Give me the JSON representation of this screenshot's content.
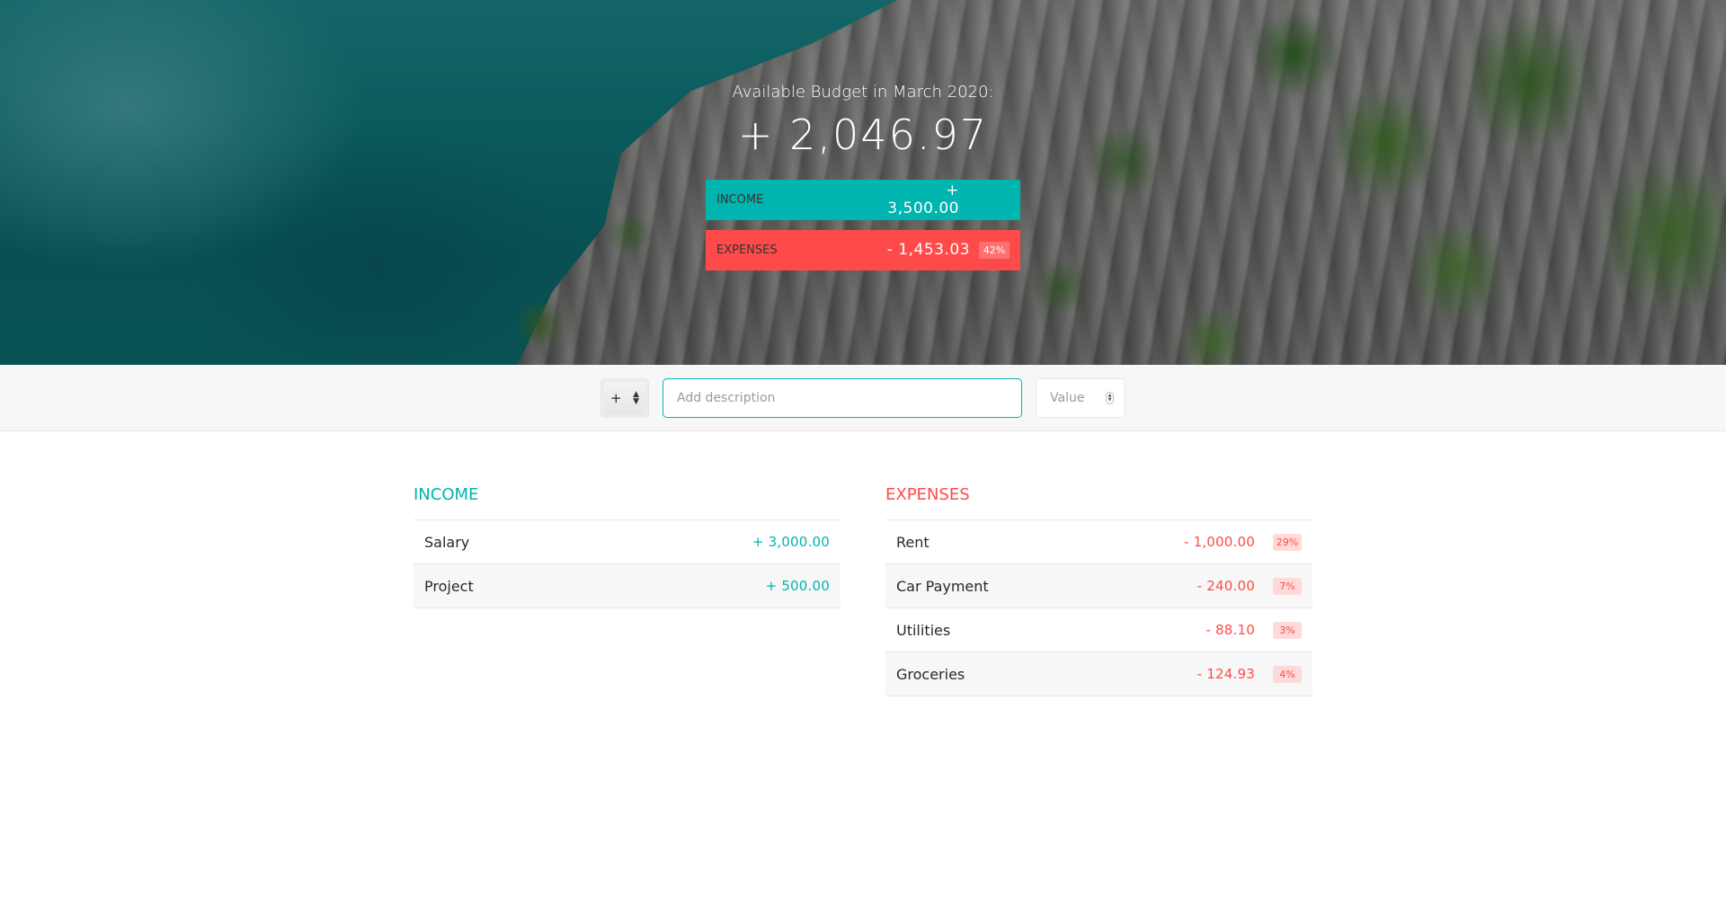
{
  "header": {
    "title": "Available Budget in March 2020:",
    "budget": "+ 2,046.97",
    "income_label": "Income",
    "income_value": "+ 3,500.00",
    "expenses_label": "Expenses",
    "expenses_value": "- 1,453.03",
    "expenses_percentage": "42%"
  },
  "add_form": {
    "type_selected": "+",
    "description_placeholder": "Add description",
    "value_placeholder": "Value"
  },
  "income": {
    "title": "Income",
    "items": [
      {
        "description": "Salary",
        "value": "+ 3,000.00"
      },
      {
        "description": "Project",
        "value": "+ 500.00"
      }
    ]
  },
  "expenses": {
    "title": "Expenses",
    "items": [
      {
        "description": "Rent",
        "value": "- 1,000.00",
        "percentage": "29%"
      },
      {
        "description": "Car Payment",
        "value": "- 240.00",
        "percentage": "7%"
      },
      {
        "description": "Utilities",
        "value": "- 88.10",
        "percentage": "3%"
      },
      {
        "description": "Groceries",
        "value": "- 124.93",
        "percentage": "4%"
      }
    ]
  },
  "colors": {
    "income": "#00b4af",
    "expenses": "#ff4a4a"
  }
}
